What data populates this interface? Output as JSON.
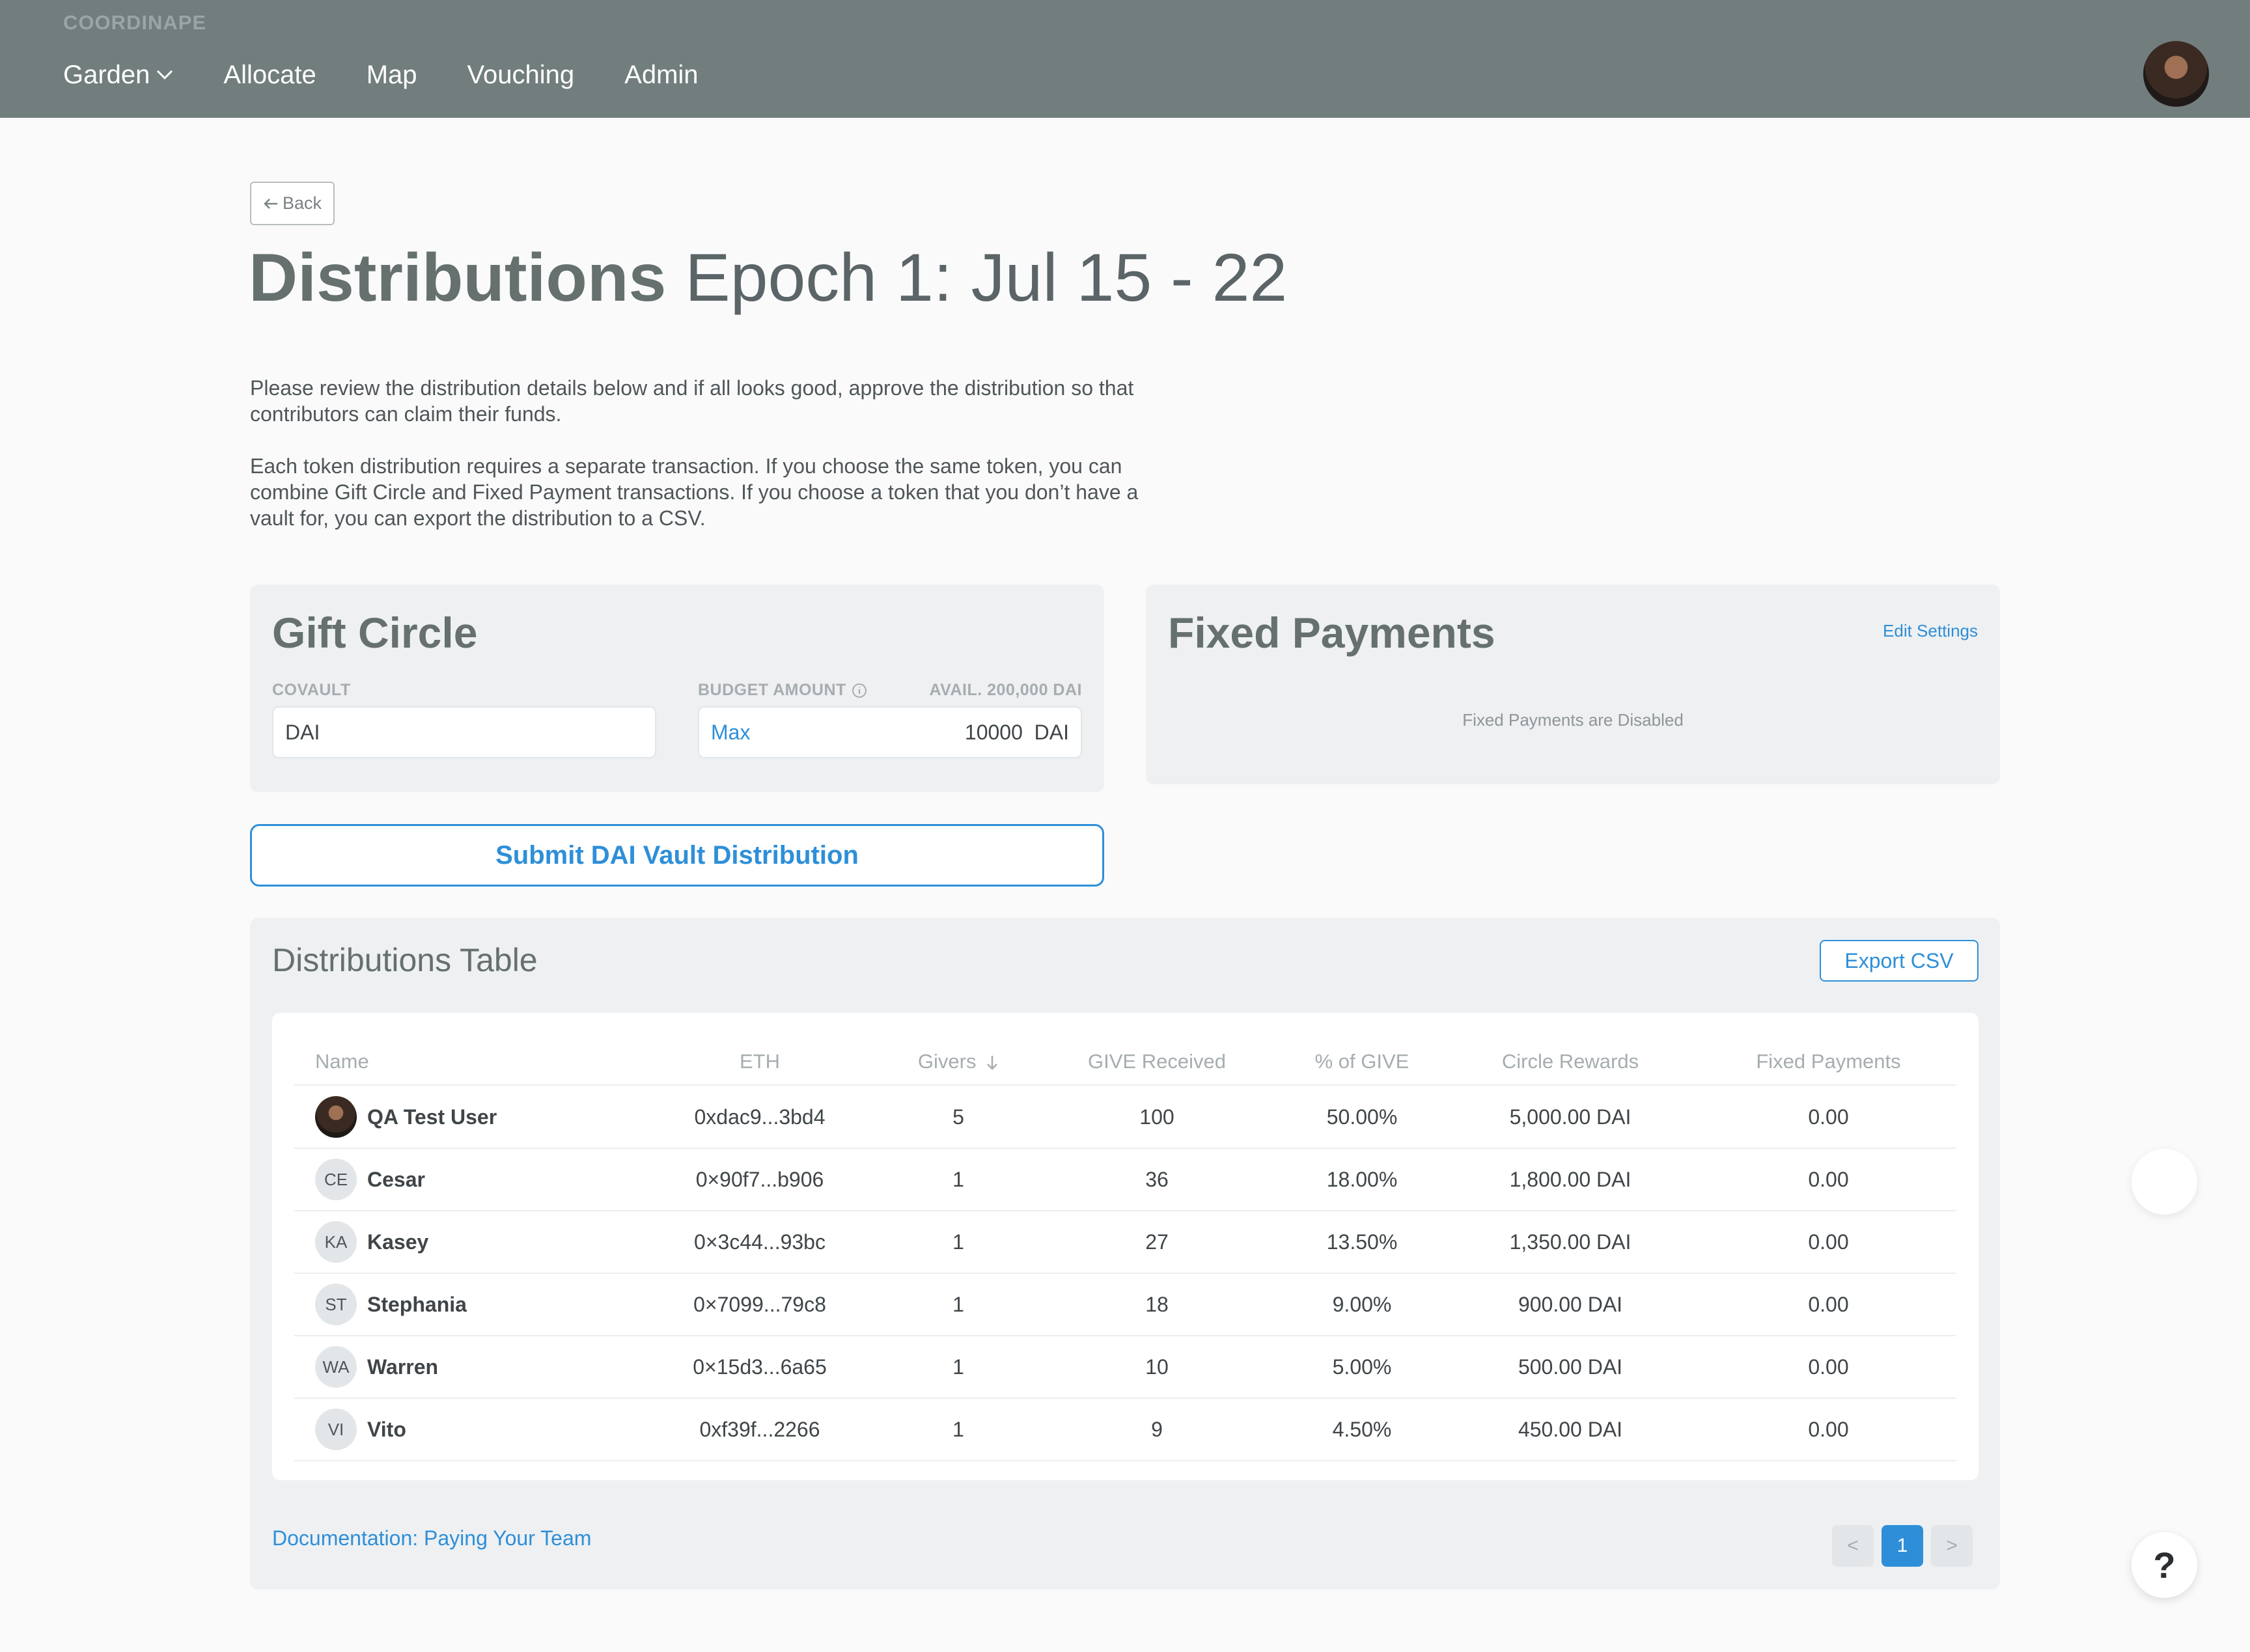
{
  "brand": "COORDINAPE",
  "nav": {
    "items": [
      "Garden",
      "Allocate",
      "Map",
      "Vouching",
      "Admin"
    ]
  },
  "back_label": "Back",
  "title": {
    "bold": "Distributions",
    "epoch": "Epoch 1: Jul 15 - 22"
  },
  "description": [
    "Please review the distribution details below and if all looks good, approve the distribution so that contributors can claim their funds.",
    "Each token distribution requires a separate transaction. If you choose the same token, you can combine Gift Circle and Fixed Payment transactions. If you choose a token that you don’t have a vault for, you can export the distribution to a CSV."
  ],
  "gift_circle": {
    "title": "Gift Circle",
    "covault_label": "COVAULT",
    "covault_value": "DAI",
    "budget_label": "BUDGET AMOUNT",
    "avail_label": "AVAIL. 200,000 DAI",
    "max_label": "Max",
    "budget_value": "10000",
    "budget_unit": "DAI"
  },
  "submit_label": "Submit DAI Vault Distribution",
  "fixed_payments": {
    "title": "Fixed Payments",
    "edit_label": "Edit Settings",
    "disabled_text": "Fixed Payments are Disabled"
  },
  "table": {
    "title": "Distributions Table",
    "export_label": "Export CSV",
    "columns": [
      "Name",
      "ETH",
      "Givers",
      "GIVE Received",
      "% of GIVE",
      "Circle Rewards",
      "Fixed Payments"
    ],
    "rows": [
      {
        "initials": "",
        "name": "QA Test User",
        "eth": "0xdac9...3bd4",
        "givers": "5",
        "received": "100",
        "pct": "50.00%",
        "rewards": "5,000.00 DAI",
        "fixed": "0.00"
      },
      {
        "initials": "CE",
        "name": "Cesar",
        "eth": "0×90f7...b906",
        "givers": "1",
        "received": "36",
        "pct": "18.00%",
        "rewards": "1,800.00 DAI",
        "fixed": "0.00"
      },
      {
        "initials": "KA",
        "name": "Kasey",
        "eth": "0×3c44...93bc",
        "givers": "1",
        "received": "27",
        "pct": "13.50%",
        "rewards": "1,350.00 DAI",
        "fixed": "0.00"
      },
      {
        "initials": "ST",
        "name": "Stephania",
        "eth": "0×7099...79c8",
        "givers": "1",
        "received": "18",
        "pct": "9.00%",
        "rewards": "900.00 DAI",
        "fixed": "0.00"
      },
      {
        "initials": "WA",
        "name": "Warren",
        "eth": "0×15d3...6a65",
        "givers": "1",
        "received": "10",
        "pct": "5.00%",
        "rewards": "500.00 DAI",
        "fixed": "0.00"
      },
      {
        "initials": "VI",
        "name": "Vito",
        "eth": "0xf39f...2266",
        "givers": "1",
        "received": "9",
        "pct": "4.50%",
        "rewards": "450.00 DAI",
        "fixed": "0.00"
      }
    ],
    "doc_link": "Documentation: Paying Your Team",
    "pager": {
      "prev": "<",
      "page": "1",
      "next": ">"
    }
  },
  "help_label": "?"
}
